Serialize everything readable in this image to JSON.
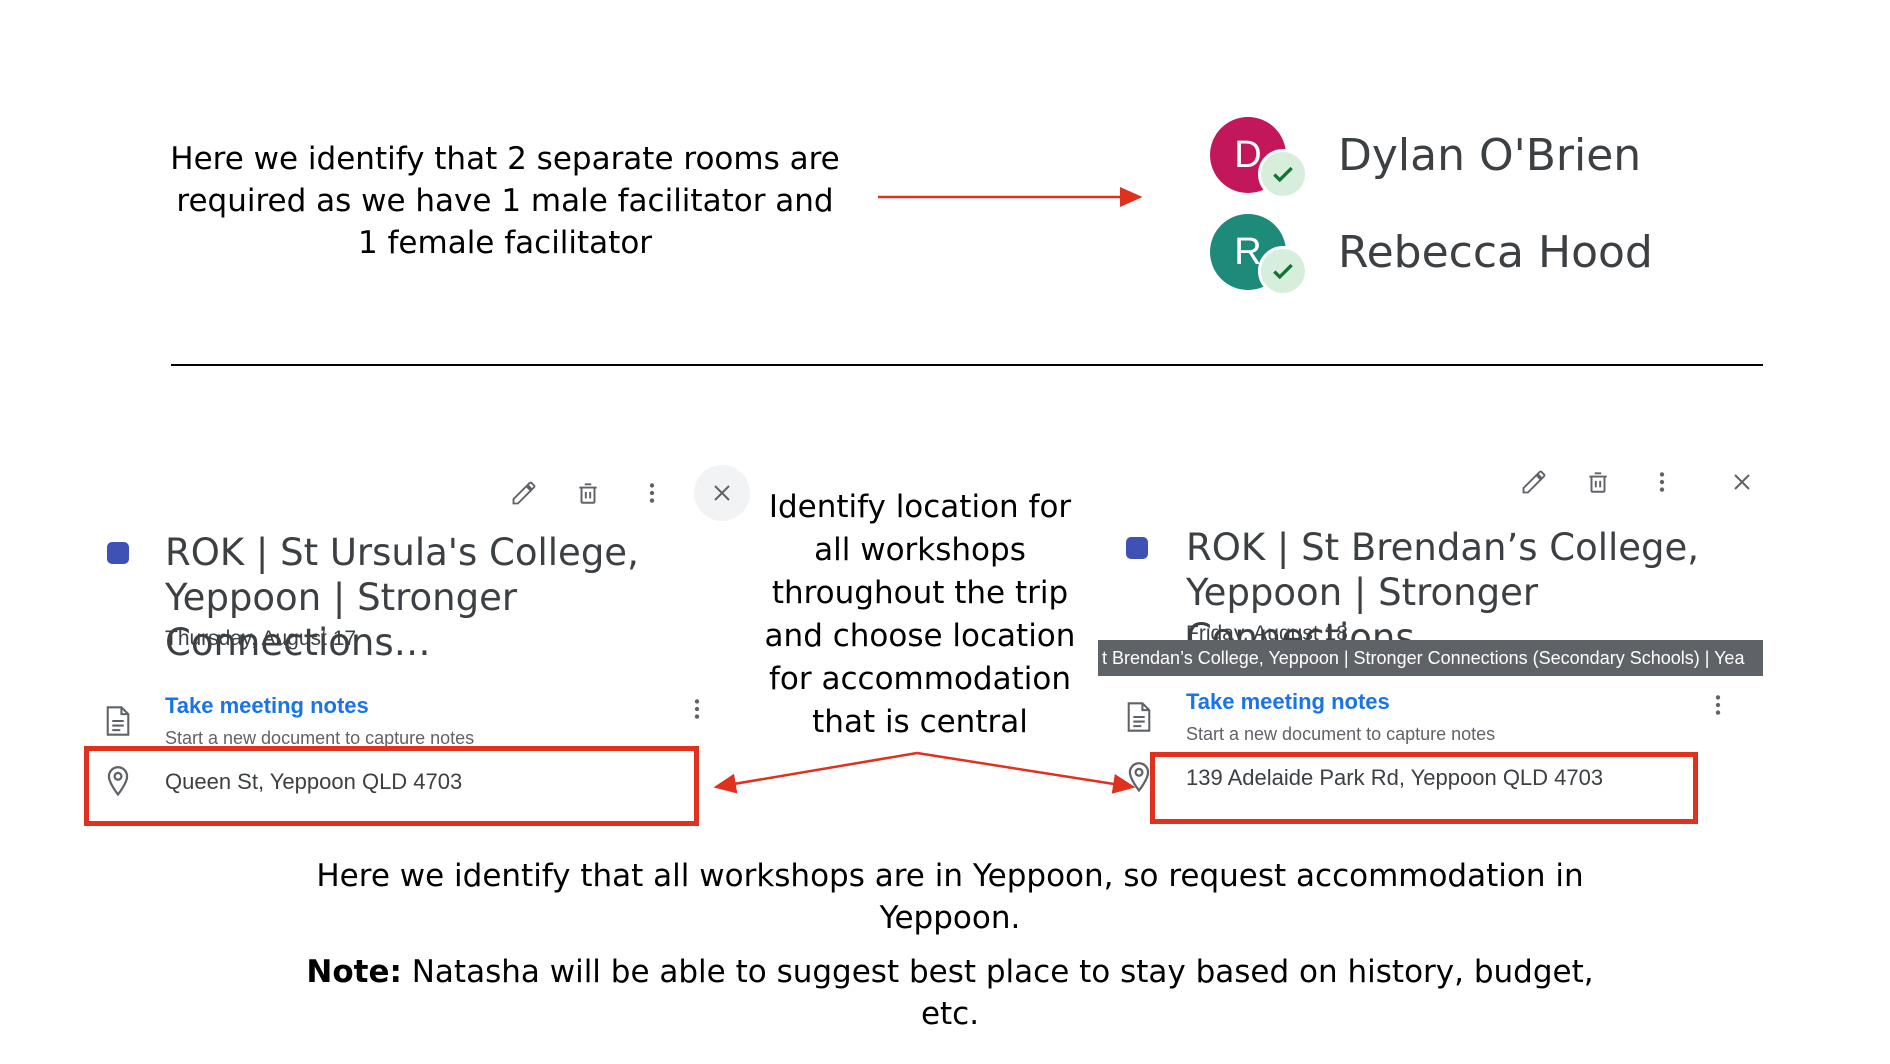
{
  "annotations": {
    "top_note": "Here we identify that 2 separate rooms are required as we have 1 male facilitator and 1 female facilitator",
    "middle_note": "Identify location for all workshops throughout the trip and choose location for accommodation that is central",
    "bottom_note": "Here we identify that all workshops are in Yeppoon, so request accommodation in Yeppoon.",
    "bottom_note2_bold": "Note:",
    "bottom_note2": " Natasha will be able to suggest best place to stay based on history, budget, etc."
  },
  "attendees": [
    {
      "initial": "D",
      "name": "Dylan O'Brien",
      "color": "#c2185b"
    },
    {
      "initial": "R",
      "name": "Rebecca Hood",
      "color": "#1e8a7a"
    }
  ],
  "events": [
    {
      "title": "ROK | St Ursula's College, Yeppoon | Stronger Connections…",
      "date": "Thursday, August 17",
      "notes_link": "Take meeting notes",
      "notes_sub": "Start a new document to capture notes",
      "address": "Queen St, Yeppoon QLD 4703",
      "dot_color": "#3f51b5"
    },
    {
      "title": "ROK | St Brendan’s College, Yeppoon | Stronger Connections…",
      "date": "Friday, August 18",
      "tooltip": "t Brendan’s College, Yeppoon | Stronger Connections (Secondary Schools) | Yea",
      "notes_link": "Take meeting notes",
      "notes_sub": "Start a new document to capture notes",
      "address": "139 Adelaide Park Rd, Yeppoon QLD 4703",
      "dot_color": "#3f51b5"
    }
  ],
  "colors": {
    "annotation_red": "#e0301e",
    "link_blue": "#1a73e8"
  },
  "icons": [
    "edit-icon",
    "delete-icon",
    "more-vert-icon",
    "close-icon",
    "document-icon",
    "location-pin-icon",
    "check-icon"
  ]
}
